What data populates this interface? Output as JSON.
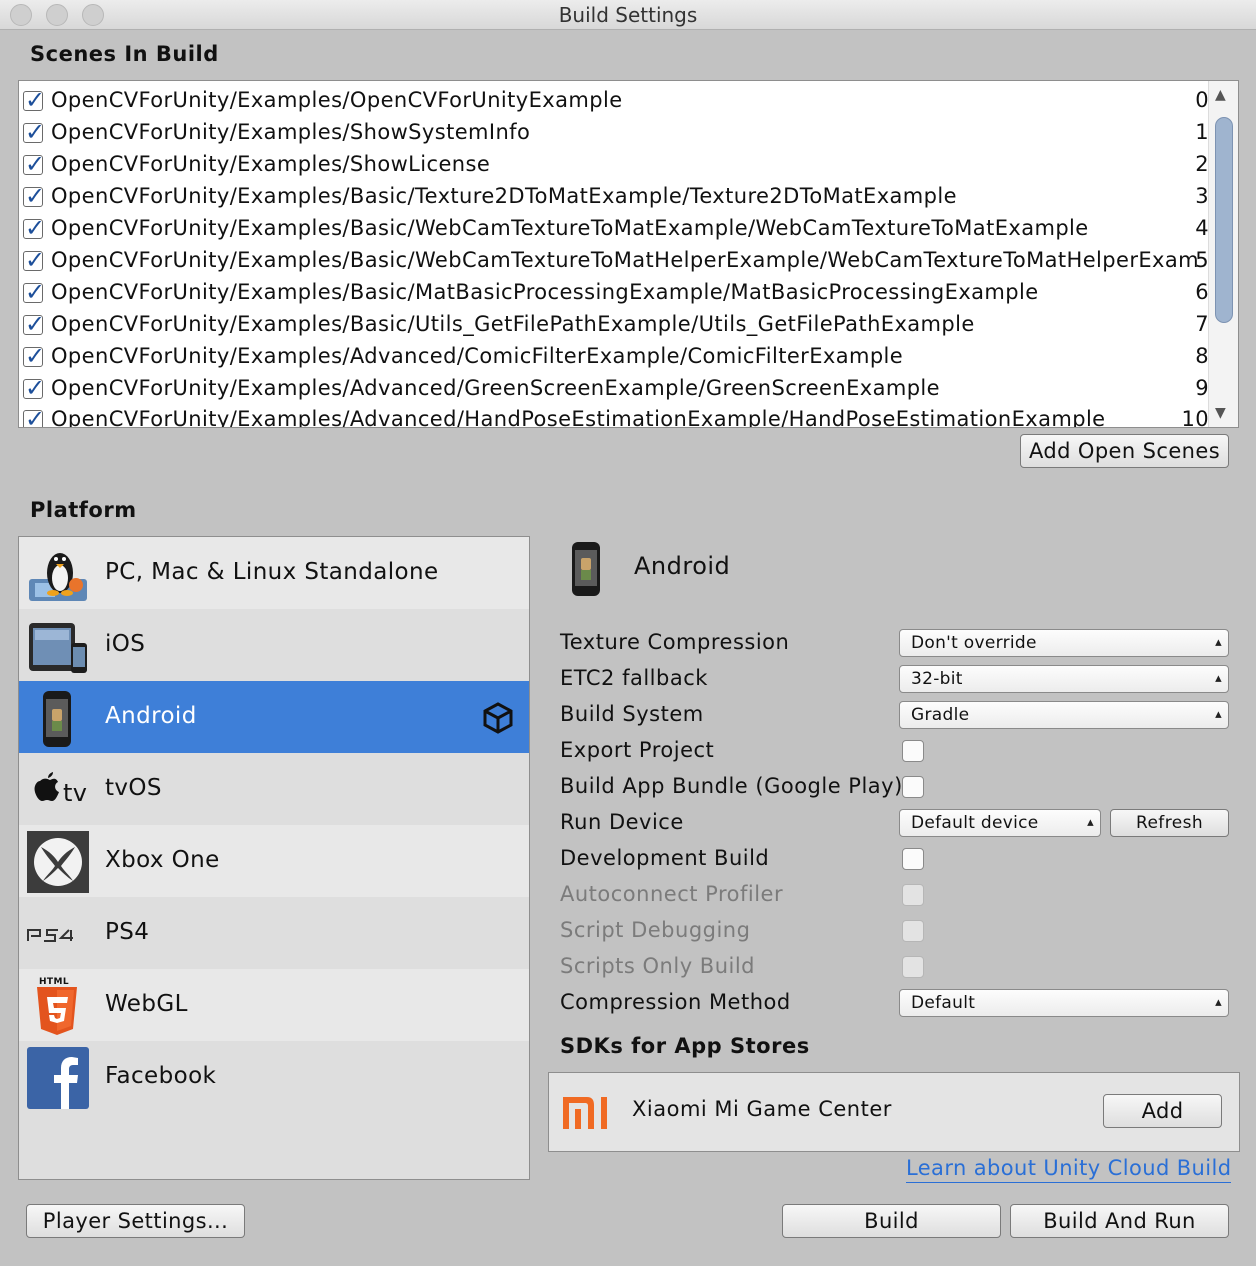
{
  "window": {
    "title": "Build Settings"
  },
  "scenes": {
    "label": "Scenes In Build",
    "items": [
      {
        "path": "OpenCVForUnity/Examples/OpenCVForUnityExample",
        "index": "0"
      },
      {
        "path": "OpenCVForUnity/Examples/ShowSystemInfo",
        "index": "1"
      },
      {
        "path": "OpenCVForUnity/Examples/ShowLicense",
        "index": "2"
      },
      {
        "path": "OpenCVForUnity/Examples/Basic/Texture2DToMatExample/Texture2DToMatExample",
        "index": "3"
      },
      {
        "path": "OpenCVForUnity/Examples/Basic/WebCamTextureToMatExample/WebCamTextureToMatExample",
        "index": "4"
      },
      {
        "path": "OpenCVForUnity/Examples/Basic/WebCamTextureToMatHelperExample/WebCamTextureToMatHelperExam",
        "index": "5"
      },
      {
        "path": "OpenCVForUnity/Examples/Basic/MatBasicProcessingExample/MatBasicProcessingExample",
        "index": "6"
      },
      {
        "path": "OpenCVForUnity/Examples/Basic/Utils_GetFilePathExample/Utils_GetFilePathExample",
        "index": "7"
      },
      {
        "path": "OpenCVForUnity/Examples/Advanced/ComicFilterExample/ComicFilterExample",
        "index": "8"
      },
      {
        "path": "OpenCVForUnity/Examples/Advanced/GreenScreenExample/GreenScreenExample",
        "index": "9"
      },
      {
        "path": "OpenCVForUnity/Examples/Advanced/HandPoseEstimationExample/HandPoseEstimationExample",
        "index": "10"
      }
    ],
    "add_open_scenes": "Add Open Scenes"
  },
  "platform": {
    "label": "Platform",
    "items": [
      {
        "name": "PC, Mac & Linux Standalone",
        "icon": "linux-penguin-icon"
      },
      {
        "name": "iOS",
        "icon": "ipad-icon"
      },
      {
        "name": "Android",
        "icon": "android-phone-icon",
        "selected": true
      },
      {
        "name": "tvOS",
        "icon": "apple-tv-icon"
      },
      {
        "name": "Xbox One",
        "icon": "xbox-icon"
      },
      {
        "name": "PS4",
        "icon": "ps4-icon"
      },
      {
        "name": "WebGL",
        "icon": "html5-icon"
      },
      {
        "name": "Facebook",
        "icon": "facebook-icon"
      }
    ],
    "unity_badge_icon": "unity-logo-icon"
  },
  "settings": {
    "platform_title": "Android",
    "texture_compression": {
      "label": "Texture Compression",
      "value": "Don't override"
    },
    "etc2_fallback": {
      "label": "ETC2 fallback",
      "value": "32-bit"
    },
    "build_system": {
      "label": "Build System",
      "value": "Gradle"
    },
    "export_project": {
      "label": "Export Project"
    },
    "build_app_bundle": {
      "label": "Build App Bundle (Google Play)"
    },
    "run_device": {
      "label": "Run Device",
      "value": "Default device",
      "refresh": "Refresh"
    },
    "development_build": {
      "label": "Development Build"
    },
    "autoconnect_profiler": {
      "label": "Autoconnect Profiler"
    },
    "script_debugging": {
      "label": "Script Debugging"
    },
    "scripts_only_build": {
      "label": "Scripts Only Build"
    },
    "compression_method": {
      "label": "Compression Method",
      "value": "Default"
    }
  },
  "sdks": {
    "label": "SDKs for App Stores",
    "item": {
      "name": "Xiaomi Mi Game Center",
      "logo": "mi",
      "add": "Add"
    }
  },
  "footer": {
    "cloud_build_link": "Learn about Unity Cloud Build",
    "player_settings": "Player Settings...",
    "build": "Build",
    "build_and_run": "Build And Run"
  },
  "colors": {
    "selection": "#3e7fd8",
    "link": "#2a6fd6",
    "xiaomi": "#f06a23"
  }
}
